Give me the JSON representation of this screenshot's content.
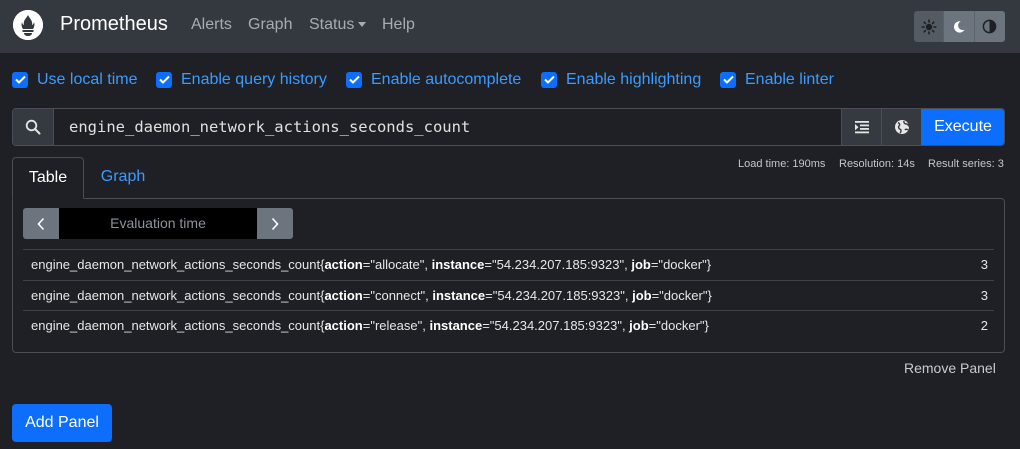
{
  "nav": {
    "brand": "Prometheus",
    "items": [
      "Alerts",
      "Graph",
      "Status",
      "Help"
    ]
  },
  "theme": {
    "buttons": [
      "sun-icon",
      "moon-icon",
      "contrast-icon"
    ]
  },
  "options": [
    {
      "label": "Use local time",
      "checked": true
    },
    {
      "label": "Enable query history",
      "checked": true
    },
    {
      "label": "Enable autocomplete",
      "checked": true
    },
    {
      "label": "Enable highlighting",
      "checked": true
    },
    {
      "label": "Enable linter",
      "checked": true
    }
  ],
  "query": {
    "expression": "engine_daemon_network_actions_seconds_count",
    "execute_label": "Execute"
  },
  "stats": {
    "load_time": "Load time: 190ms",
    "resolution": "Resolution: 14s",
    "result_series": "Result series: 3"
  },
  "tabs": {
    "table": "Table",
    "graph": "Graph"
  },
  "evaluation": {
    "placeholder": "Evaluation time"
  },
  "results": [
    {
      "metric": "engine_daemon_network_actions_seconds_count",
      "action": "allocate",
      "instance": "54.234.207.185:9323",
      "job": "docker",
      "value": "3"
    },
    {
      "metric": "engine_daemon_network_actions_seconds_count",
      "action": "connect",
      "instance": "54.234.207.185:9323",
      "job": "docker",
      "value": "3"
    },
    {
      "metric": "engine_daemon_network_actions_seconds_count",
      "action": "release",
      "instance": "54.234.207.185:9323",
      "job": "docker",
      "value": "2"
    }
  ],
  "label_keys": {
    "action": "action",
    "instance": "instance",
    "job": "job"
  },
  "panel": {
    "remove_label": "Remove Panel",
    "add_label": "Add Panel"
  },
  "colors": {
    "accent": "#0d6efd",
    "link": "#3b9bff",
    "navbar": "#34383f",
    "background": "#1e2025"
  }
}
